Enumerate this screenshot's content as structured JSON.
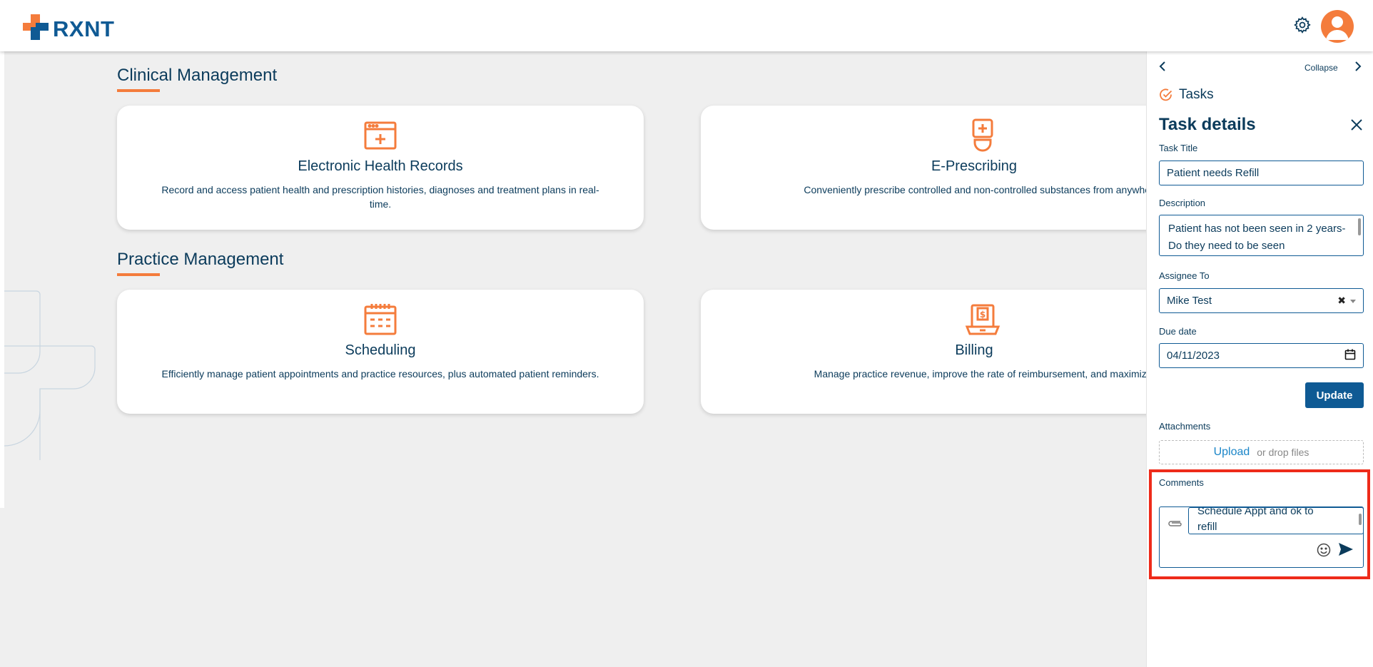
{
  "header": {
    "logo_text": "RXNT",
    "settings_icon": "gear-icon",
    "avatar_icon": "user-avatar-icon"
  },
  "colors": {
    "brand_blue": "#0f5a94",
    "accent_orange": "#f47c3c",
    "highlight_red": "#ee2b1a"
  },
  "sections": {
    "clinical": {
      "title": "Clinical Management",
      "cards": [
        {
          "icon": "ehr-browser-icon",
          "title": "Electronic Health Records",
          "desc": "Record and access patient health and prescription histories, diagnoses and treatment plans in real-time."
        },
        {
          "icon": "prescription-bottle-icon",
          "title": "E-Prescribing",
          "desc": "Conveniently prescribe controlled and non-controlled substances from anywhere, at a"
        }
      ]
    },
    "practice": {
      "title": "Practice Management",
      "cards": [
        {
          "icon": "calendar-icon",
          "title": "Scheduling",
          "desc": "Efficiently manage patient appointments and practice resources, plus automated patient reminders."
        },
        {
          "icon": "billing-laptop-icon",
          "title": "Billing",
          "desc": "Manage practice revenue, improve the rate of reimbursement, and maximize profita"
        }
      ]
    }
  },
  "panel": {
    "collapse_label": "Collapse",
    "tasks_label": "Tasks",
    "heading": "Task details",
    "task_title_label": "Task Title",
    "task_title_value": "Patient needs Refill",
    "description_label": "Description",
    "description_value": "Patient has not been seen in 2 years- Do they need to be seen",
    "assignee_label": "Assignee To",
    "assignee_value": "Mike Test",
    "due_label": "Due date",
    "due_value": "04/11/2023",
    "update_label": "Update",
    "attachments_label": "Attachments",
    "upload_label": "Upload",
    "drop_label": "or drop files",
    "comments_label": "Comments",
    "comment_line1": "Schedule Appt and ok to",
    "comment_line2": "refill"
  }
}
